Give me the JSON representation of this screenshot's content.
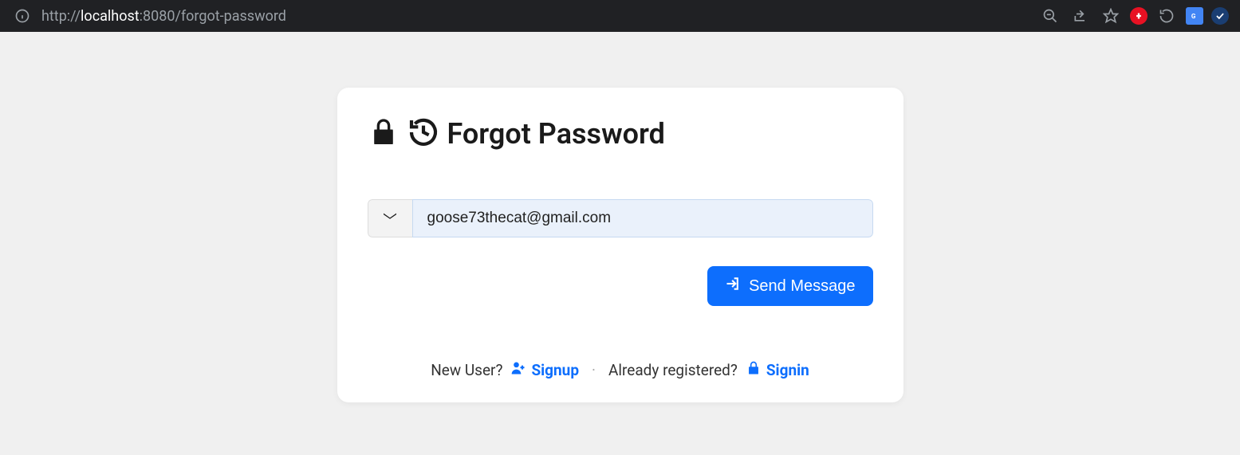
{
  "browser": {
    "url_protocol": "http://",
    "url_host": "localhost",
    "url_port_path": ":8080/forgot-password"
  },
  "card": {
    "title": "Forgot Password",
    "email_value": "goose73thecat@gmail.com",
    "send_label": "Send Message"
  },
  "footer": {
    "new_user_text": "New User?",
    "signup_label": "Signup",
    "separator": "·",
    "registered_text": "Already registered?",
    "signin_label": "Signin"
  }
}
